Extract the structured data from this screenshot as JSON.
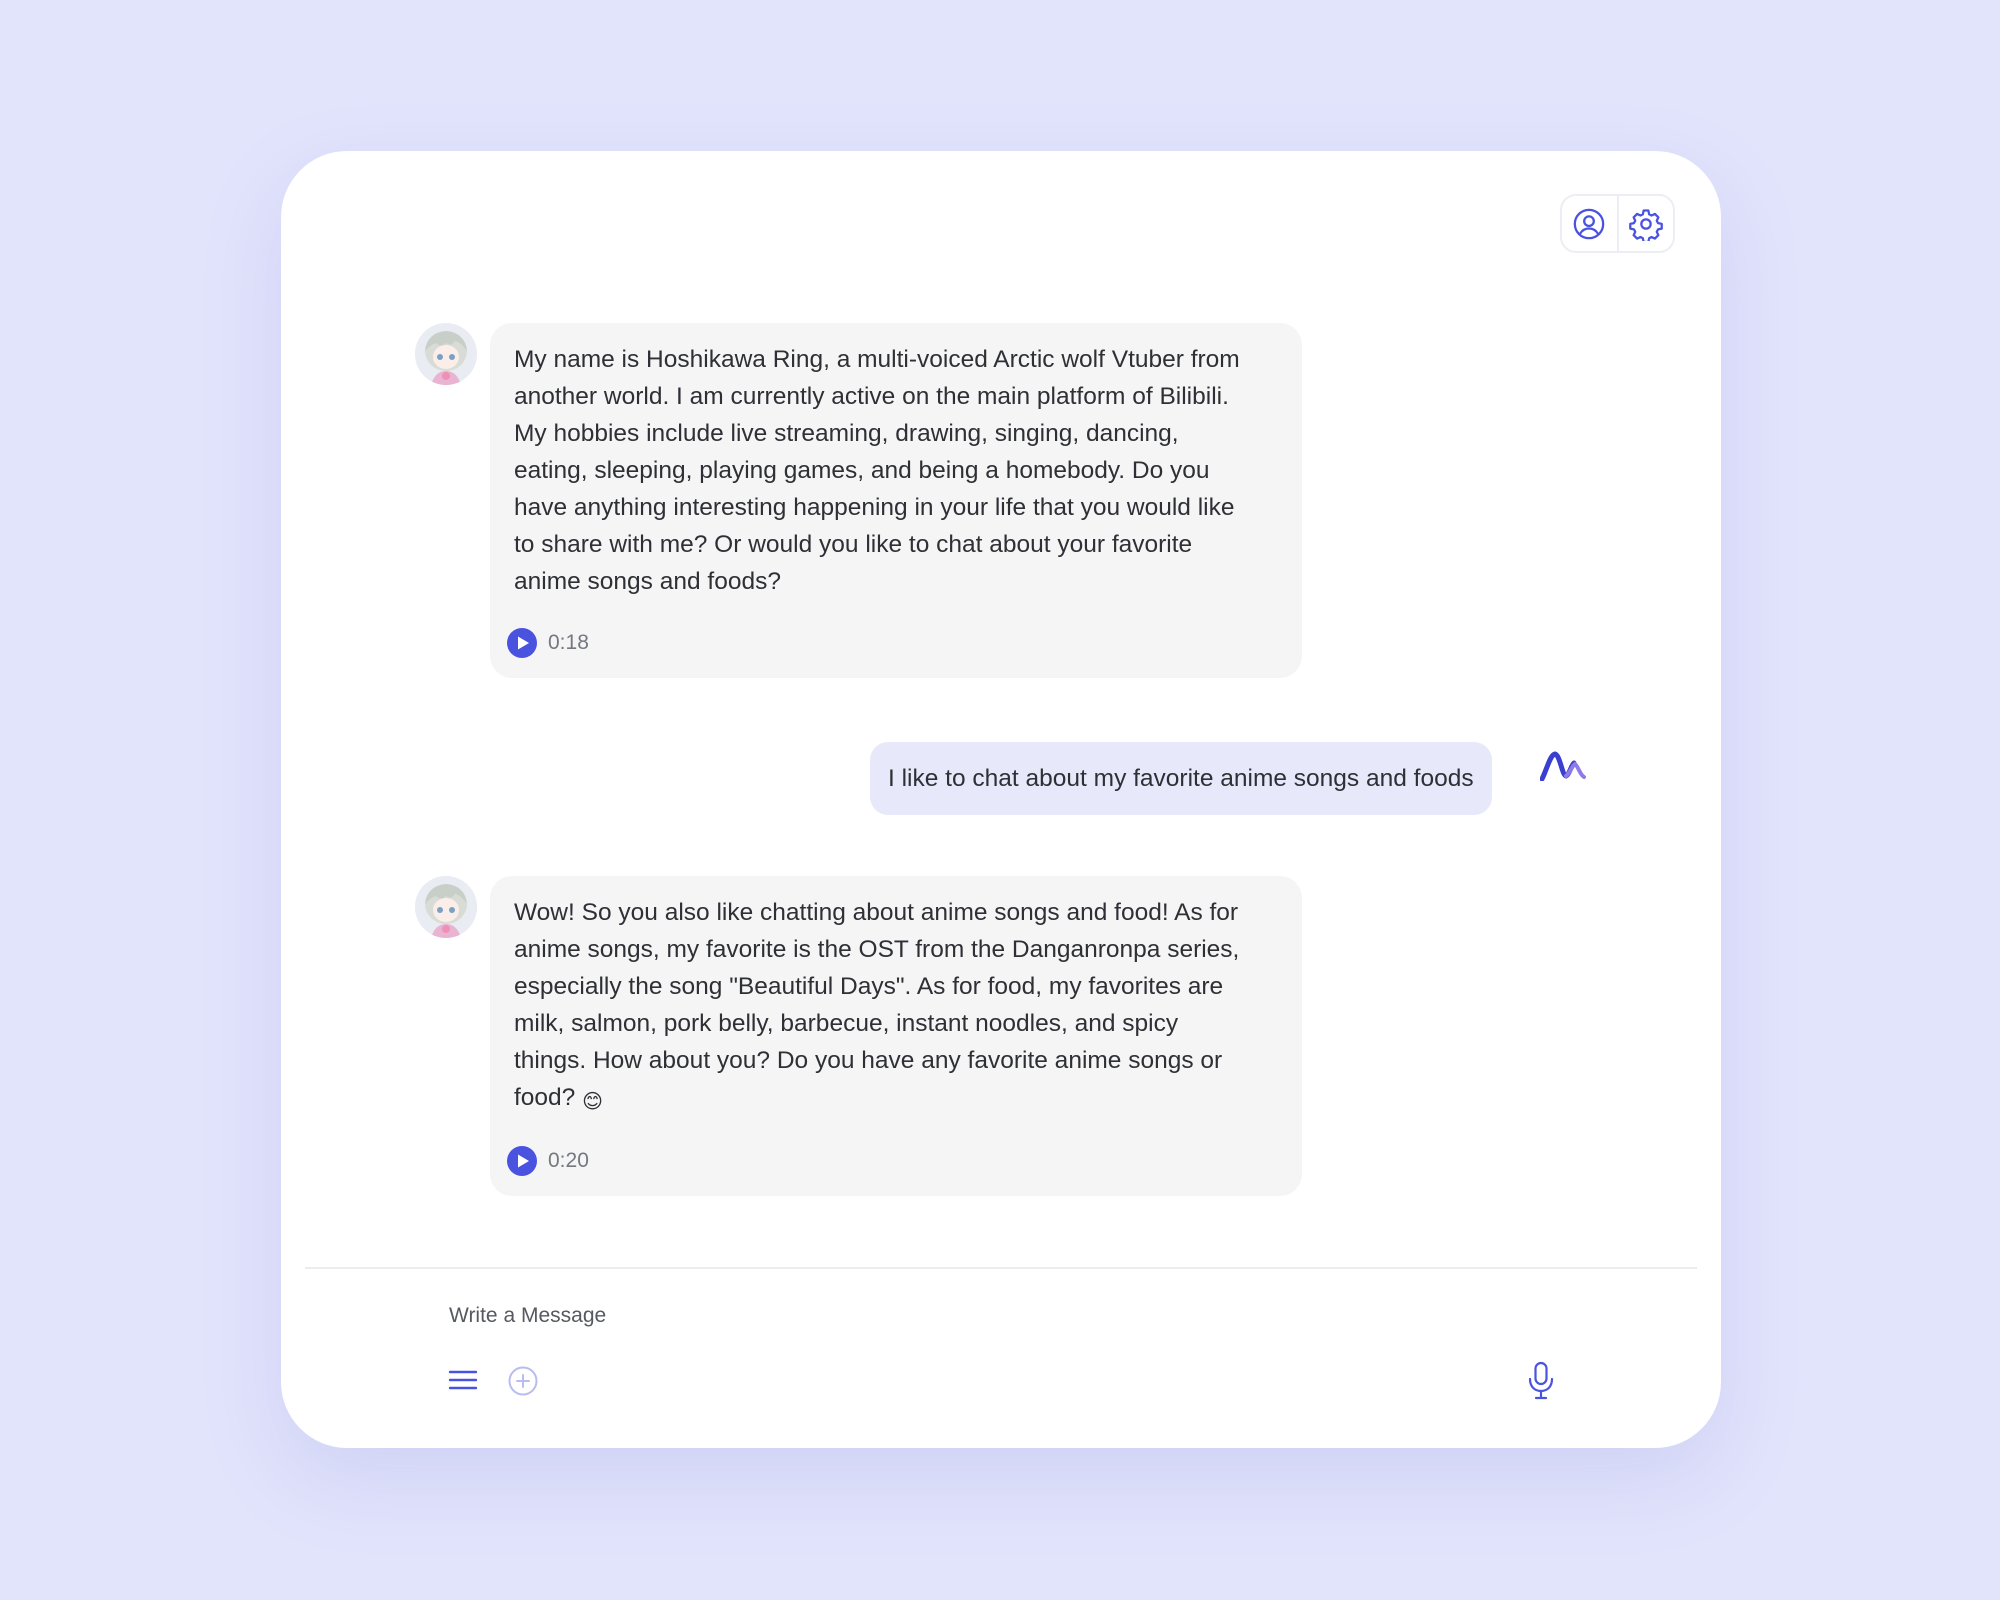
{
  "colors": {
    "background": "#e2e4fc",
    "accent": "#4a52e0",
    "bot_bubble": "#f5f5f6",
    "user_bubble": "#e7e9fb"
  },
  "header": {
    "icons": [
      "user-circle-icon",
      "gear-icon"
    ]
  },
  "messages": [
    {
      "role": "bot",
      "avatar": "character-avatar",
      "text": "My name is Hoshikawa Ring, a multi-voiced Arctic wolf Vtuber from\nanother world. I am currently active on the main platform of Bilibili.\nMy hobbies include live streaming, drawing, singing, dancing,\neating, sleeping, playing games, and being a homebody. Do you\nhave anything interesting happening in your life that you would like\nto share with me? Or would you like to chat about your favorite\nanime songs and foods?",
      "audio_duration": "0:18"
    },
    {
      "role": "user",
      "text": "I like to chat about my favorite anime songs and foods"
    },
    {
      "role": "bot",
      "avatar": "character-avatar",
      "text": "Wow! So you also like chatting about anime songs and food! As for\nanime songs, my favorite is the OST from the Danganronpa series,\nespecially the song \"Beautiful Days\". As for food, my favorites are\nmilk, salmon, pork belly, barbecue, instant noodles, and spicy\nthings. How about you? Do you have any favorite anime songs or\nfood?",
      "emoji": "😊",
      "audio_duration": "0:20"
    }
  ],
  "composer": {
    "placeholder": "Write a Message",
    "icons": [
      "menu-icon",
      "add-icon",
      "microphone-icon"
    ]
  }
}
